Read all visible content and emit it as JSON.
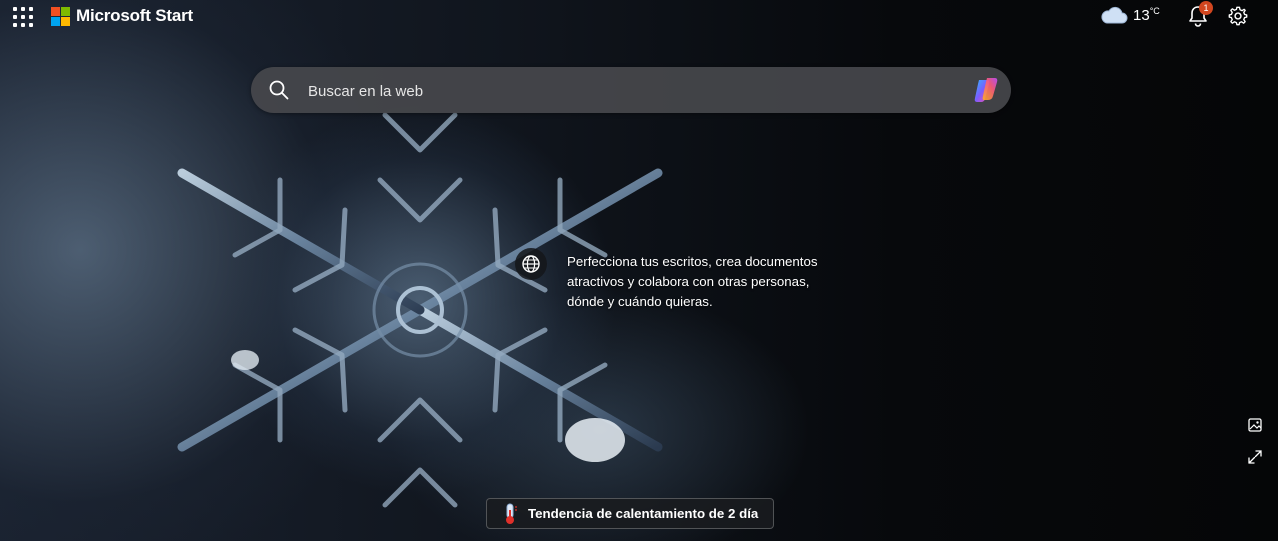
{
  "header": {
    "brand_name": "Microsoft Start",
    "weather": {
      "temperature": "13",
      "unit": "°C",
      "icon": "cloud-icon"
    },
    "notifications": {
      "count": "1",
      "icon": "bell-icon"
    },
    "settings_icon": "gear-icon",
    "apps_icon": "app-launcher-icon"
  },
  "search": {
    "placeholder": "Buscar en la web",
    "value": ""
  },
  "background_info": {
    "description": "Perfecciona tus escritos, crea documentos atractivos y colabora con otras personas, dónde y cuándo quieras."
  },
  "trending": {
    "label": "Tendencia de calentamiento de 2 día",
    "icon": "thermometer-icon"
  },
  "colors": {
    "ms_red": "#f25022",
    "ms_green": "#7fba00",
    "ms_blue": "#00a4ef",
    "ms_yellow": "#ffb900",
    "badge": "#d1461f"
  }
}
